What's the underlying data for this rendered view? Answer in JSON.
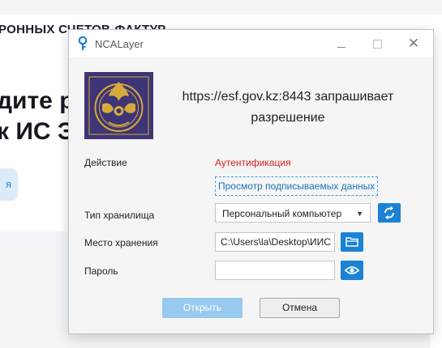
{
  "background": {
    "header_text": "РОННЫХ СЧЕТОВ-ФАКТУР",
    "hero_line1": "дите р",
    "hero_line2": "к ИС ЭС",
    "hero_button": "я"
  },
  "dialog": {
    "title": "NCALayer",
    "request_line1": "https://esf.gov.kz:8443 запрашивает",
    "request_line2": "разрешение",
    "action_label": "Действие",
    "action_value": "Аутентификация",
    "view_data_link": "Просмотр подписываемых данных",
    "storage_type_label": "Тип хранилища",
    "storage_type_value": "Персональный компьютер",
    "storage_place_label": "Место хранения",
    "storage_place_value": "C:\\Users\\la\\Desktop\\ИИС",
    "password_label": "Пароль",
    "password_value": "",
    "ok_button": "Открыть",
    "cancel_button": "Отмена",
    "icons": [
      "ncalayer-key-icon",
      "minimize-icon",
      "maximize-icon",
      "close-icon",
      "emblem-icon",
      "refresh-icon",
      "folder-icon",
      "eye-icon"
    ]
  },
  "colors": {
    "accent": "#1b82d4",
    "action_red": "#d42020",
    "link_blue": "#1977b7",
    "ok_disabled": "#98c9ee",
    "emblem_bg": "#3d3576",
    "emblem_gold": "#d6a93c"
  }
}
